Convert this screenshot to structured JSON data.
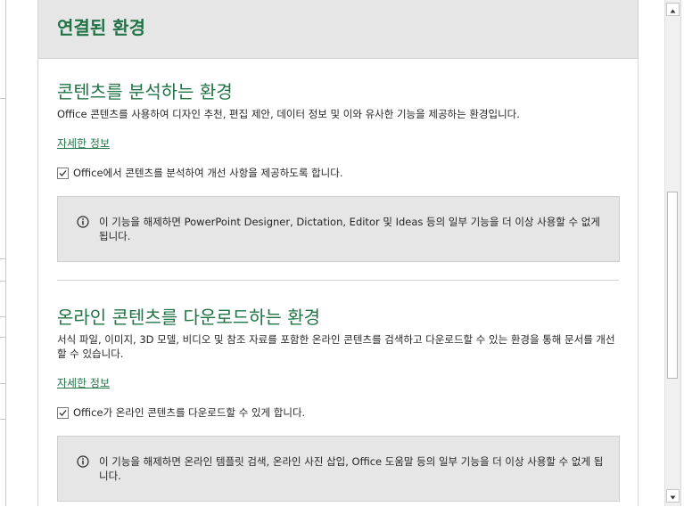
{
  "header": {
    "title": "연결된 환경"
  },
  "section_analyze": {
    "title": "콘텐츠를 분석하는 환경",
    "description": "Office 콘텐츠를 사용하여 디자인 추천, 편집 제안, 데이터 정보 및 이와 유사한 기능을 제공하는 환경입니다.",
    "link_label": "자세한 정보",
    "checkbox_label": "Office에서 콘텐츠를 분석하여 개선 사항을 제공하도록 합니다.",
    "checkbox_checked": true,
    "info_text": "이 기능을 해제하면 PowerPoint Designer, Dictation, Editor 및 Ideas 등의 일부 기능을 더 이상 사용할 수 없게 됩니다."
  },
  "section_download": {
    "title": "온라인 콘텐츠를 다운로드하는 환경",
    "description": "서식 파일, 이미지, 3D 모델, 비디오 및 참조 자료를 포함한 온라인 콘텐츠를 검색하고 다운로드할 수 있는 환경을 통해 문서를 개선할 수 있습니다.",
    "link_label": "자세한 정보",
    "checkbox_label": "Office가 온라인 콘텐츠를 다운로드할 수 있게 합니다.",
    "checkbox_checked": true,
    "info_text": "이 기능을 해제하면 온라인 템플릿 검색, 온라인 사진 삽입, Office 도움말 등의 일부 기능을 더 이상 사용할 수 없게 됩니다."
  },
  "colors": {
    "accent_green": "#217346",
    "header_band": "#e6e6e6",
    "info_box": "#e6e6e6"
  },
  "icons": {
    "scroll_up": "chevron-up-icon",
    "scroll_down": "chevron-down-icon",
    "info": "info-icon",
    "checkbox": "checkmark-icon"
  }
}
